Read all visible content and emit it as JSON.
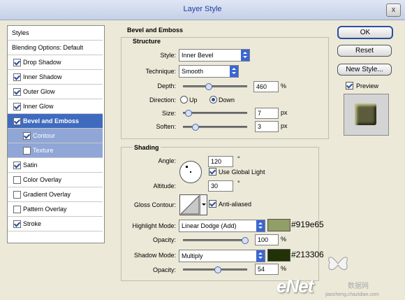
{
  "window": {
    "title": "Layer Style",
    "close_glyph": "x"
  },
  "sidebar": {
    "items": [
      {
        "label": "Styles",
        "kind": "header"
      },
      {
        "label": "Blending Options: Default",
        "kind": "header"
      },
      {
        "label": "Drop Shadow",
        "checked": true
      },
      {
        "label": "Inner Shadow",
        "checked": true
      },
      {
        "label": "Outer Glow",
        "checked": true
      },
      {
        "label": "Inner Glow",
        "checked": true
      },
      {
        "label": "Bevel and Emboss",
        "checked": true,
        "selected": true
      },
      {
        "label": "Contour",
        "checked": true,
        "sub": true
      },
      {
        "label": "Texture",
        "checked": false,
        "sub": true
      },
      {
        "label": "Satin",
        "checked": true
      },
      {
        "label": "Color Overlay",
        "checked": false
      },
      {
        "label": "Gradient Overlay",
        "checked": false
      },
      {
        "label": "Pattern Overlay",
        "checked": false
      },
      {
        "label": "Stroke",
        "checked": true
      }
    ]
  },
  "bevel": {
    "section_title": "Bevel and Emboss",
    "structure_title": "Structure",
    "style_label": "Style:",
    "style_value": "Inner Bevel",
    "technique_label": "Technique:",
    "technique_value": "Smooth",
    "depth_label": "Depth:",
    "depth_value": "460",
    "depth_unit": "%",
    "depth_level": 0.38,
    "direction_label": "Direction:",
    "dir_up": "Up",
    "dir_down": "Down",
    "direction_selected": "Down",
    "size_label": "Size:",
    "size_value": "7",
    "size_unit": "px",
    "size_level": 0.03,
    "soften_label": "Soften:",
    "soften_value": "3",
    "soften_unit": "px",
    "soften_level": 0.15
  },
  "shading": {
    "title": "Shading",
    "angle_label": "Angle:",
    "angle_value": "120",
    "angle_unit": "°",
    "global_light_label": "Use Global Light",
    "global_light_checked": true,
    "altitude_label": "Altitude:",
    "altitude_value": "30",
    "altitude_unit": "°",
    "gloss_label": "Gloss Contour:",
    "anti_aliased_label": "Anti-aliased",
    "anti_aliased_checked": true,
    "highlight_label": "Highlight Mode:",
    "highlight_mode": "Linear Dodge (Add)",
    "highlight_color": "#919e65",
    "highlight_hex": "#919e65",
    "h_opacity_label": "Opacity:",
    "h_opacity_value": "100",
    "h_opacity_unit": "%",
    "h_opacity_level": 1.0,
    "shadow_label": "Shadow Mode:",
    "shadow_mode": "Multiply",
    "shadow_color": "#213306",
    "shadow_hex": "#213306",
    "s_opacity_label": "Opacity:",
    "s_opacity_value": "54",
    "s_opacity_unit": "%",
    "s_opacity_level": 0.54
  },
  "buttons": {
    "ok": "OK",
    "reset": "Reset",
    "new_style": "New Style...",
    "preview_label": "Preview",
    "preview_checked": true
  },
  "watermark": {
    "brand": "eNet",
    "cn": "数据网",
    "url": "jiaocheng.chazidian.com"
  }
}
